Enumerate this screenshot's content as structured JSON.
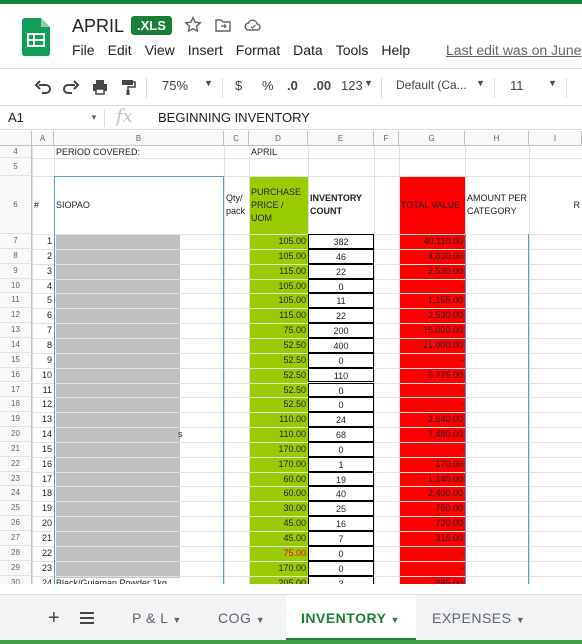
{
  "app": {
    "title": "APRIL",
    "badge": ".XLS"
  },
  "menu": [
    "File",
    "Edit",
    "View",
    "Insert",
    "Format",
    "Data",
    "Tools",
    "Help"
  ],
  "last_edit": "Last edit was on June",
  "toolbar": {
    "zoom": "75%",
    "currency": "$",
    "percent": "%",
    "dec_dec": ".0",
    "dec_inc": ".00",
    "format_more": "123",
    "font": "Default (Ca...",
    "font_size": "11"
  },
  "formula": {
    "cell_ref": "A1",
    "content": "BEGINNING INVENTORY"
  },
  "columns": [
    "A",
    "B",
    "C",
    "D",
    "E",
    "F",
    "G",
    "H",
    "I"
  ],
  "header_rows": {
    "r4_period": "PERIOD COVERED:",
    "r4_month": "APRIL",
    "r6_num": "#",
    "r6_item": "SIOPAO",
    "r6_qty": "Qty/ pack",
    "r6_price": "PURCHASE PRICE / UOM",
    "r6_count": "INVENTORY COUNT",
    "r6_total": "TOTAL VALUE",
    "r6_amount": "AMOUNT PER CATEGORY",
    "r6_extra": "R"
  },
  "row_numbers": [
    "4",
    "5",
    "6",
    "7",
    "8",
    "9",
    "10",
    "11",
    "12",
    "13",
    "14",
    "15",
    "16",
    "17",
    "18",
    "19",
    "20",
    "21",
    "22",
    "23",
    "24",
    "25",
    "26",
    "27",
    "28",
    "29",
    "30"
  ],
  "rows": [
    {
      "n": "1",
      "price": "105.00",
      "count": "382",
      "total": "40,110.00",
      "suffix": ""
    },
    {
      "n": "2",
      "price": "105.00",
      "count": "46",
      "total": "4,830.00",
      "suffix": ""
    },
    {
      "n": "3",
      "price": "115.00",
      "count": "22",
      "total": "2,530.00",
      "suffix": ""
    },
    {
      "n": "4",
      "price": "105.00",
      "count": "0",
      "total": "-",
      "suffix": ""
    },
    {
      "n": "5",
      "price": "105.00",
      "count": "11",
      "total": "1,155.00",
      "suffix": ""
    },
    {
      "n": "6",
      "price": "115.00",
      "count": "22",
      "total": "2,530.00",
      "suffix": ""
    },
    {
      "n": "7",
      "price": "75.00",
      "count": "200",
      "total": "15,000.00",
      "suffix": ""
    },
    {
      "n": "8",
      "price": "52.50",
      "count": "400",
      "total": "21,000.00",
      "suffix": ""
    },
    {
      "n": "9",
      "price": "52.50",
      "count": "0",
      "total": "-",
      "suffix": ""
    },
    {
      "n": "10",
      "price": "52.50",
      "count": "110",
      "total": "5,775.00",
      "suffix": ""
    },
    {
      "n": "11",
      "price": "52.50",
      "count": "0",
      "total": "-",
      "suffix": ""
    },
    {
      "n": "12",
      "price": "52.50",
      "count": "0",
      "total": "-",
      "suffix": ""
    },
    {
      "n": "13",
      "price": "110.00",
      "count": "24",
      "total": "2,640.00",
      "suffix": ""
    },
    {
      "n": "14",
      "price": "110.00",
      "count": "68",
      "total": "7,480.00",
      "suffix": "s"
    },
    {
      "n": "15",
      "price": "170.00",
      "count": "0",
      "total": "-",
      "suffix": ""
    },
    {
      "n": "16",
      "price": "170.00",
      "count": "1",
      "total": "170.00",
      "suffix": ""
    },
    {
      "n": "17",
      "price": "60.00",
      "count": "19",
      "total": "1,140.00",
      "suffix": ""
    },
    {
      "n": "18",
      "price": "60.00",
      "count": "40",
      "total": "2,400.00",
      "suffix": ""
    },
    {
      "n": "19",
      "price": "30.00",
      "count": "25",
      "total": "750.00",
      "suffix": ""
    },
    {
      "n": "20",
      "price": "45.00",
      "count": "16",
      "total": "720.00",
      "suffix": ""
    },
    {
      "n": "21",
      "price": "45.00",
      "count": "7",
      "total": "315.00",
      "suffix": ""
    },
    {
      "n": "22",
      "price": "75.00",
      "count": "0",
      "total": "-",
      "suffix": ""
    },
    {
      "n": "23",
      "price": "170.00",
      "count": "0",
      "total": "-",
      "suffix": ""
    },
    {
      "n": "24",
      "price": "205.00",
      "count": "3",
      "total": "885.00",
      "suffix": "Black/Guiaman Powder 1kg"
    }
  ],
  "sheets": [
    {
      "label": "P & L",
      "active": false
    },
    {
      "label": "COG",
      "active": false
    },
    {
      "label": "INVENTORY",
      "active": true
    },
    {
      "label": "EXPENSES",
      "active": false
    }
  ],
  "colors": {
    "green_col": "#99cc00",
    "red_col": "#ff0000",
    "redacted": "#c0c0c0",
    "brand": "#188038",
    "red_price": "#ff0000"
  }
}
